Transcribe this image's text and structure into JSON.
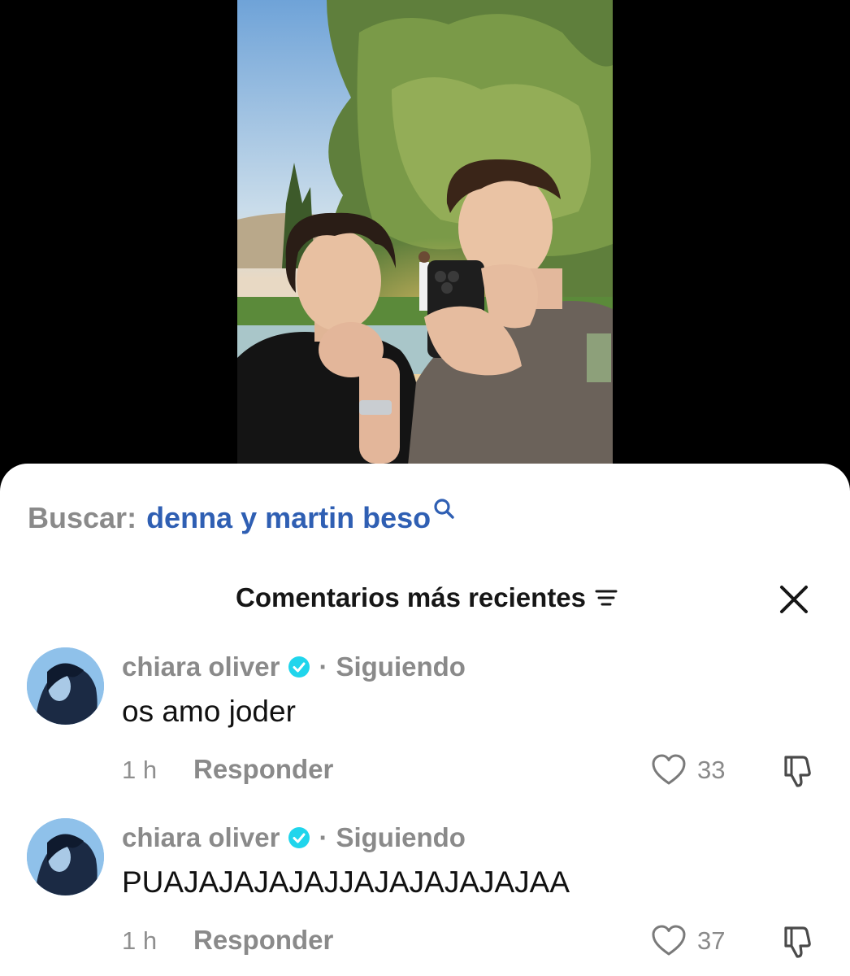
{
  "search": {
    "prefix": "Buscar:",
    "query": "denna y martin beso"
  },
  "header": {
    "sort_label": "Comentarios más recientes"
  },
  "comments": [
    {
      "username": "chiara oliver",
      "separator": "·",
      "follow_status": "Siguiendo",
      "text": "os amo joder",
      "time": "1 h",
      "reply_label": "Responder",
      "likes": "33"
    },
    {
      "username": "chiara oliver",
      "separator": "·",
      "follow_status": "Siguiendo",
      "text": "PUAJAJAJAJAJJAJAJAJAJAJAA",
      "time": "1 h",
      "reply_label": "Responder",
      "likes": "37"
    }
  ],
  "icons": {
    "search": "search-icon",
    "sort": "sort-lines-icon",
    "close": "close-icon",
    "verified": "verified-check-icon",
    "like": "heart-outline-icon",
    "dislike": "thumbs-down-icon"
  },
  "colors": {
    "search_query": "#2f5fb3",
    "verified_badge": "#20d5ec",
    "muted_text": "#8a8a8a",
    "sheet_background": "#ffffff",
    "video_background": "#000000"
  }
}
